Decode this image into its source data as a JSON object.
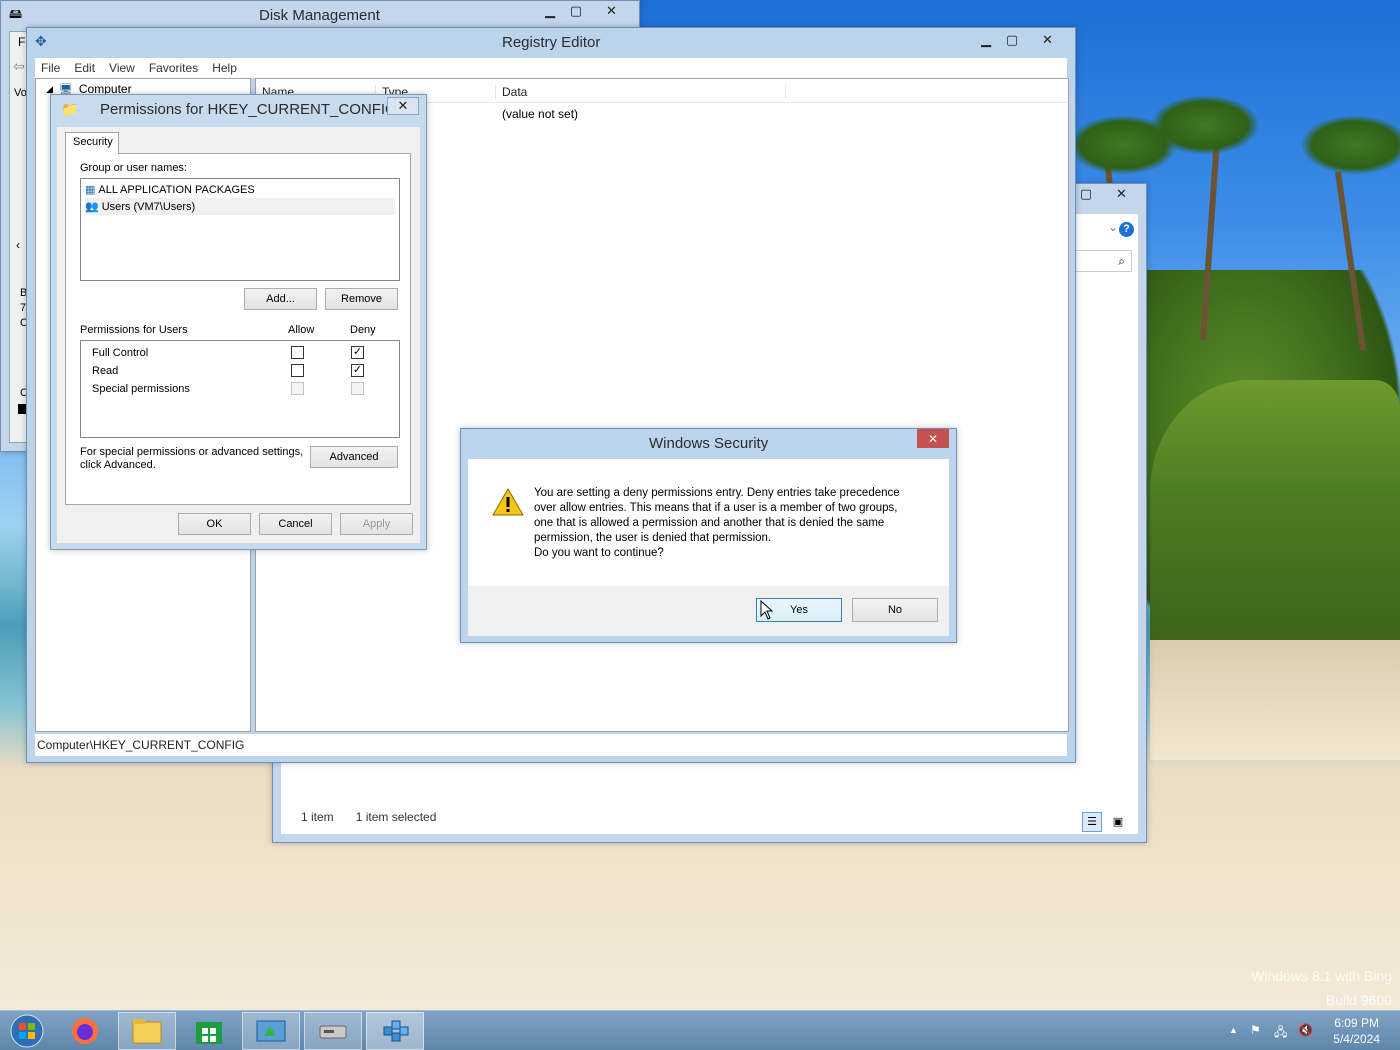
{
  "desktop": {
    "watermark_line1": "Windows 8.1 with Bing",
    "watermark_line2": "Build 9600"
  },
  "disk_management": {
    "title": "Disk Management",
    "menu_first": "Fi",
    "side_letters": [
      "Vo",
      "B",
      "7",
      "O",
      "C"
    ]
  },
  "explorer": {
    "status_items": "1 item",
    "status_selected": "1 item selected"
  },
  "registry_editor": {
    "title": "Registry Editor",
    "menu": [
      "File",
      "Edit",
      "View",
      "Favorites",
      "Help"
    ],
    "tree_root": "Computer",
    "columns": [
      "Name",
      "Type",
      "Data"
    ],
    "row_data": "(value not set)",
    "status_path": "Computer\\HKEY_CURRENT_CONFIG"
  },
  "permissions": {
    "title": "Permissions for HKEY_CURRENT_CONFIG",
    "tab": "Security",
    "group_label": "Group or user names:",
    "groups": [
      "ALL APPLICATION PACKAGES",
      "Users (VM7\\Users)"
    ],
    "add_button": "Add...",
    "remove_button": "Remove",
    "perm_label": "Permissions for Users",
    "allow_header": "Allow",
    "deny_header": "Deny",
    "perm_rows": [
      {
        "name": "Full Control",
        "allow": false,
        "deny": true
      },
      {
        "name": "Read",
        "allow": false,
        "deny": true
      },
      {
        "name": "Special permissions",
        "allow": false,
        "deny": false
      }
    ],
    "advanced_note_1": "For special permissions or advanced settings,",
    "advanced_note_2": "click Advanced.",
    "advanced_button": "Advanced",
    "ok_button": "OK",
    "cancel_button": "Cancel",
    "apply_button": "Apply"
  },
  "security_dialog": {
    "title": "Windows Security",
    "message_lines": [
      "You are setting a deny permissions entry. Deny entries take precedence",
      "over allow entries. This means that if a user is a member of two groups,",
      "one that is allowed a permission and another that is denied the same",
      "permission, the user is denied that permission.",
      "Do you want to continue?"
    ],
    "yes_button": "Yes",
    "no_button": "No"
  },
  "taskbar": {
    "time": "6:09 PM",
    "date": "5/4/2024",
    "tray_arrow": "▲"
  },
  "colors": {
    "accent": "#b9d1ea",
    "close_red": "#c75050",
    "taskbar": "#6a8fb3"
  }
}
